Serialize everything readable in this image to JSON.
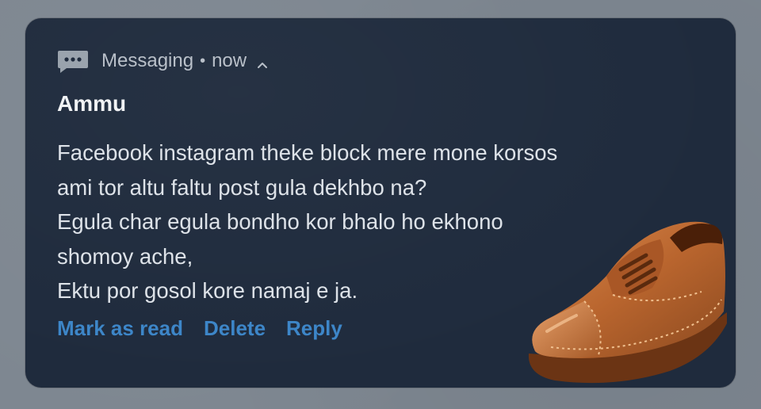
{
  "notification": {
    "app_name": "Messaging",
    "separator": "•",
    "time": "now",
    "sender": "Ammu",
    "message_lines": [
      "Facebook instagram theke block mere mone korsos",
      "ami tor altu faltu post gula dekhbo na?",
      "Egula char egula bondho kor bhalo ho ekhono",
      "shomoy ache,",
      "Ektu por gosol kore namaj e ja."
    ],
    "actions": {
      "mark_as_read": "Mark as read",
      "delete": "Delete",
      "reply": "Reply"
    }
  },
  "icons": {
    "app_icon": "message-bubble-icon",
    "expand": "chevron-up-icon",
    "sticker": "shoe-emoji"
  },
  "colors": {
    "card_background": "#1f2b3d",
    "page_background": "#7d8690",
    "action_color": "#3d86c8",
    "header_text": "#b9c0c9",
    "sender_text": "#f1f3f5",
    "message_text": "#dde2e8"
  }
}
